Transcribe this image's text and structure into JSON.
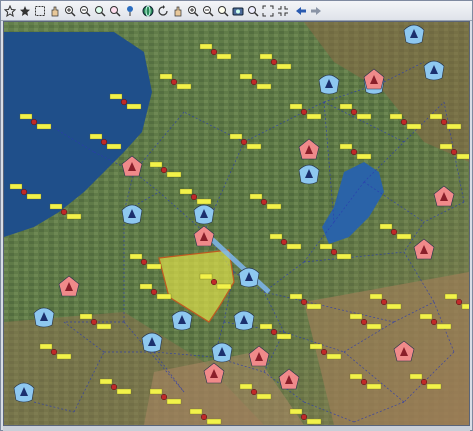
{
  "toolbar": {
    "buttons": [
      {
        "icon": "star-outline-icon"
      },
      {
        "icon": "star-filled-icon"
      },
      {
        "icon": "select-region-icon"
      },
      {
        "icon": "pan-hand-icon"
      },
      {
        "icon": "zoom-in-icon"
      },
      {
        "icon": "zoom-out-icon"
      },
      {
        "icon": "zoom-fit-icon"
      },
      {
        "icon": "zoom-window-icon"
      },
      {
        "icon": "pin-icon"
      },
      {
        "icon": "globe-icon"
      },
      {
        "icon": "refresh-icon"
      },
      {
        "icon": "hand-icon"
      },
      {
        "icon": "zoom-in-2-icon"
      },
      {
        "icon": "zoom-out-2-icon"
      },
      {
        "icon": "zoom-area-icon"
      },
      {
        "icon": "camera-icon"
      },
      {
        "icon": "zoom-all-icon"
      },
      {
        "icon": "expand-icon"
      },
      {
        "icon": "collapse-icon"
      },
      {
        "icon": "arrow-left-icon"
      },
      {
        "icon": "arrow-right-icon"
      }
    ]
  },
  "colors": {
    "friendly": "#8ec8f0",
    "hostile": "#f08a8a",
    "label_bg": "#f2f24a",
    "area_fill": "#e6e64a",
    "route_line": "#2a3ab0",
    "water": "#1f4f8a"
  },
  "map": {
    "unit_label_text": "UNIT"
  }
}
